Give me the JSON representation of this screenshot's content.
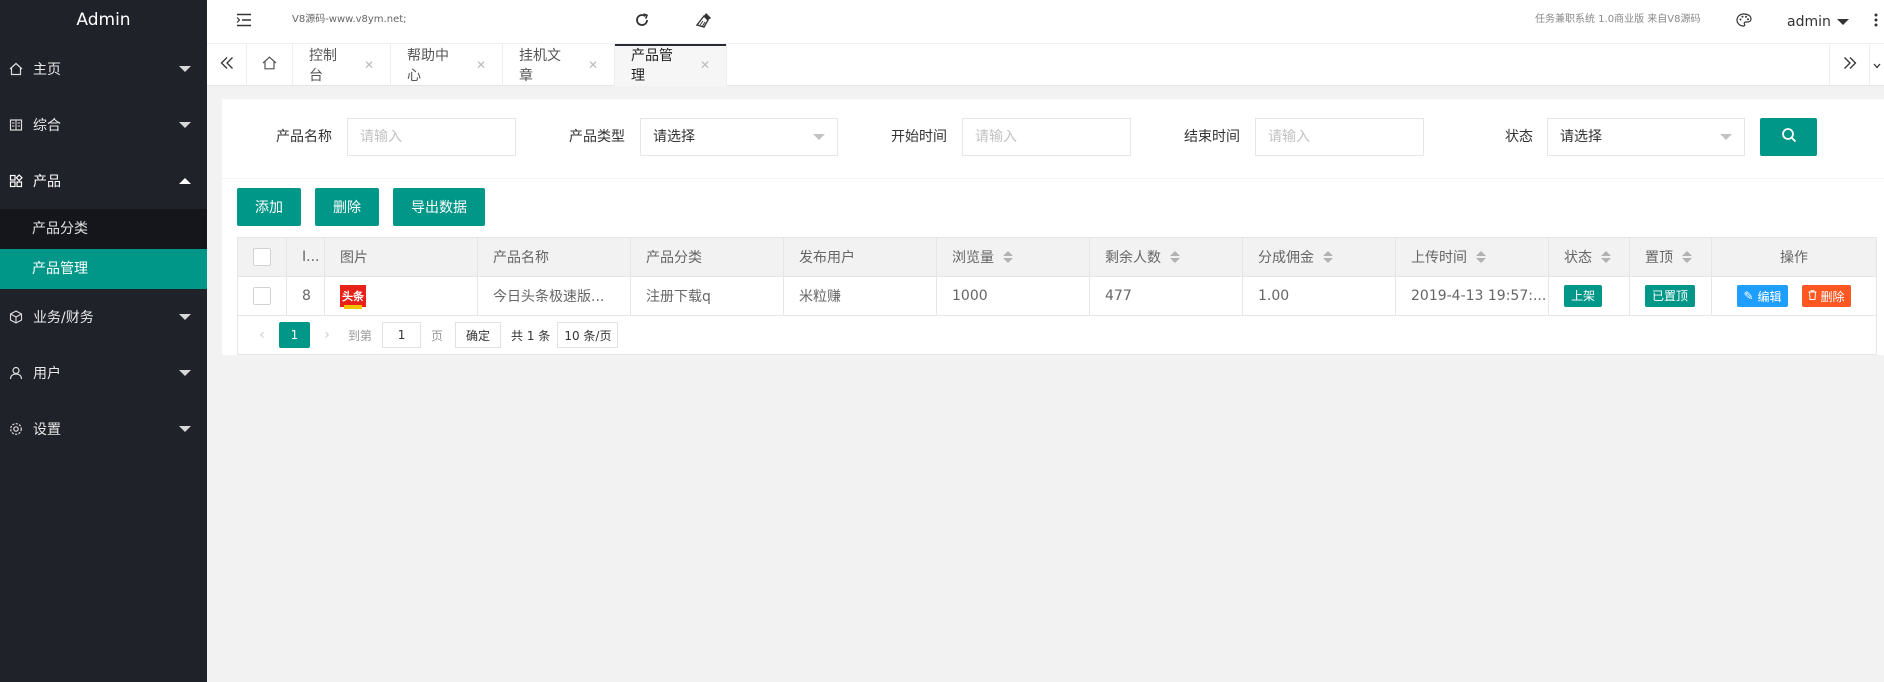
{
  "sidebar": {
    "brand": "Admin",
    "items": [
      {
        "label": "主页",
        "icon": "home-icon"
      },
      {
        "label": "综合",
        "icon": "book-icon"
      },
      {
        "label": "产品",
        "icon": "grid-icon"
      },
      {
        "label": "业务/财务",
        "icon": "cube-icon"
      },
      {
        "label": "用户",
        "icon": "user-icon"
      },
      {
        "label": "设置",
        "icon": "gear-icon"
      }
    ],
    "sub_items": [
      {
        "label": "产品分类"
      },
      {
        "label": "产品管理"
      }
    ]
  },
  "topbar": {
    "site_text": "V8源码-www.v8ym.net;",
    "system_text": "任务兼职系统 1.0商业版 来自V8源码",
    "user": "admin"
  },
  "tabs": [
    {
      "label": "控制台"
    },
    {
      "label": "帮助中心"
    },
    {
      "label": "挂机文章"
    },
    {
      "label": "产品管理"
    }
  ],
  "search": {
    "name_label": "产品名称",
    "name_placeholder": "请输入",
    "type_label": "产品类型",
    "type_value": "请选择",
    "start_label": "开始时间",
    "start_placeholder": "请输入",
    "end_label": "结束时间",
    "end_placeholder": "请输入",
    "status_label": "状态",
    "status_value": "请选择"
  },
  "actions": {
    "add": "添加",
    "delete": "删除",
    "export": "导出数据"
  },
  "table": {
    "headers": {
      "id": "I...",
      "image": "图片",
      "name": "产品名称",
      "category": "产品分类",
      "publisher": "发布用户",
      "views": "浏览量",
      "remaining": "剩余人数",
      "commission": "分成佣金",
      "upload_time": "上传时间",
      "status": "状态",
      "top": "置顶",
      "ops": "操作"
    },
    "rows": [
      {
        "id": "8",
        "image_text": "头条",
        "name": "今日头条极速版...",
        "category": "注册下载q",
        "publisher": "米粒赚",
        "views": "1000",
        "remaining": "477",
        "commission": "1.00",
        "upload_time": "2019-4-13 19:57:...",
        "status": "上架",
        "top": "已置顶",
        "edit": "编辑",
        "delete": "删除"
      }
    ]
  },
  "pager": {
    "current": "1",
    "goto_label": "到第",
    "page_value": "1",
    "page_unit": "页",
    "confirm": "确定",
    "total": "共 1 条",
    "limit": "10 条/页"
  },
  "colors": {
    "accent": "#009688",
    "sidebar_bg": "#20222a",
    "edit_blue": "#1e9fff",
    "delete_orange": "#ff5722"
  }
}
